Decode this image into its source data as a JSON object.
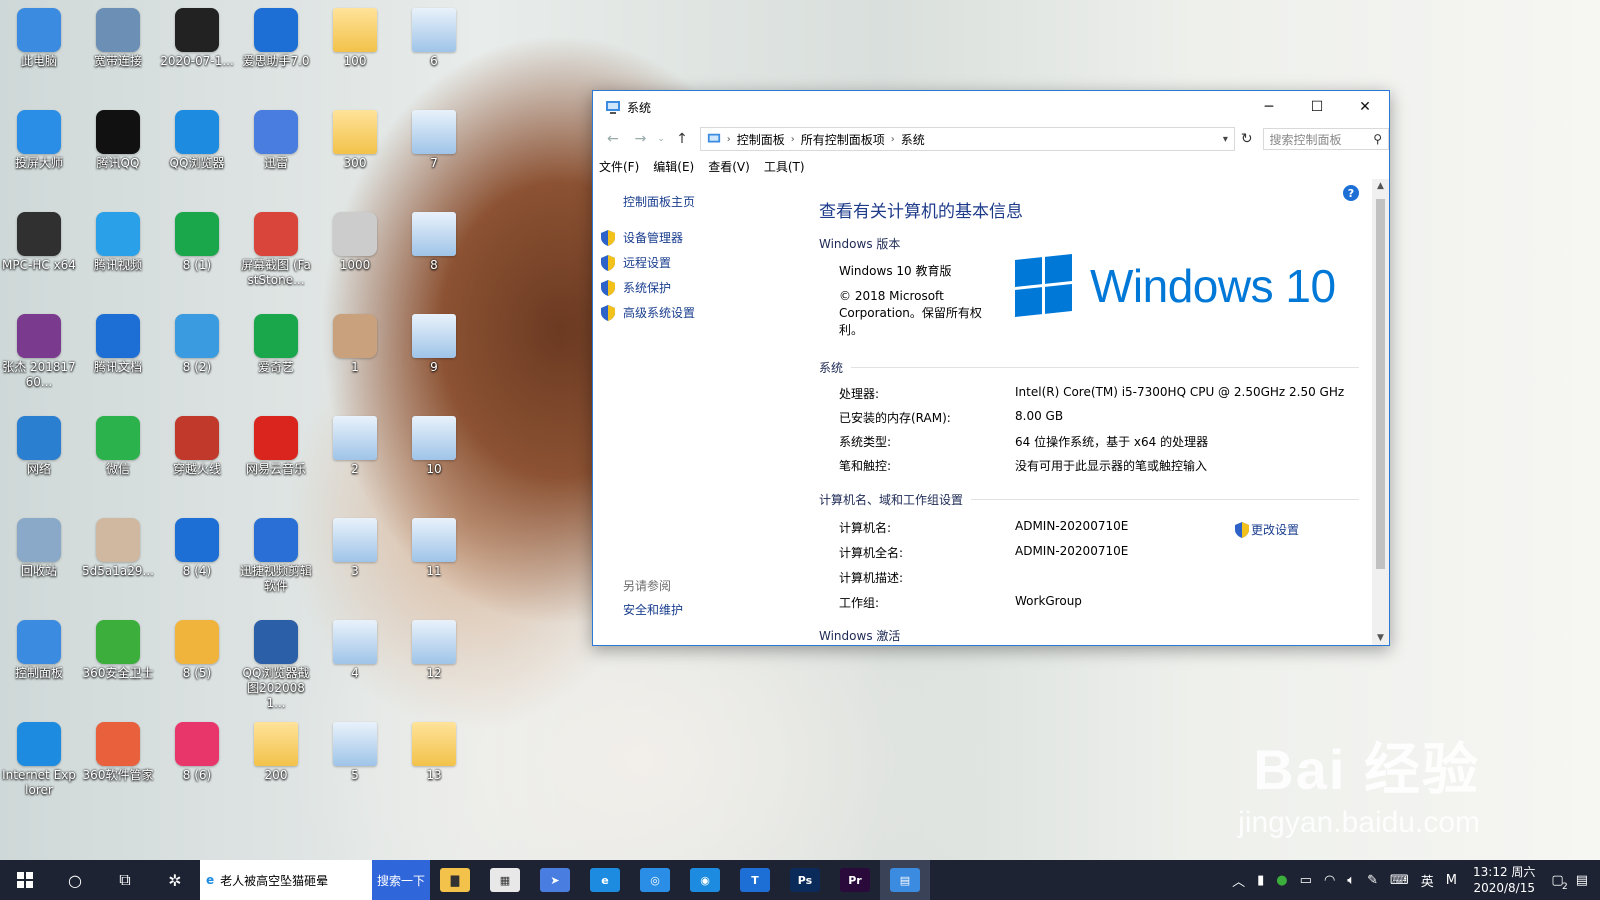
{
  "desktop": {
    "icons": [
      {
        "label": "此电脑",
        "color": "#3b8be0",
        "icon": "computer-icon"
      },
      {
        "label": "宽带连接",
        "color": "#6c8fb5",
        "icon": "broadband-icon"
      },
      {
        "label": "2020-07-1...",
        "color": "#222222",
        "icon": "video-thumbnail-icon"
      },
      {
        "label": "爱思助手7.0",
        "color": "#1d6fd6",
        "icon": "i4-assistant-icon"
      },
      {
        "label": "100",
        "color": "#333333",
        "icon": "folder-icon"
      },
      {
        "label": "6",
        "color": "#5b9be0",
        "icon": "document-icon"
      },
      {
        "label": "投屏大师",
        "color": "#2a8ee6",
        "icon": "screen-cast-icon"
      },
      {
        "label": "腾讯QQ",
        "color": "#111111",
        "icon": "qq-icon"
      },
      {
        "label": "QQ浏览器",
        "color": "#1d8ce0",
        "icon": "qq-browser-icon"
      },
      {
        "label": "迅雷",
        "color": "#4a7de0",
        "icon": "thunder-icon"
      },
      {
        "label": "300",
        "color": "#d86aa0",
        "icon": "folder-icon"
      },
      {
        "label": "7",
        "color": "#5b9be0",
        "icon": "document-icon"
      },
      {
        "label": "MPC-HC x64",
        "color": "#303030",
        "icon": "mpc-hc-icon"
      },
      {
        "label": "腾讯视频",
        "color": "#2aa0e8",
        "icon": "tencent-video-icon"
      },
      {
        "label": "8 (1)",
        "color": "#1aa64a",
        "icon": "iqiyi-icon"
      },
      {
        "label": "屏幕截图 (FastStone...",
        "color": "#d9453a",
        "icon": "faststone-icon"
      },
      {
        "label": "1000",
        "color": "#cccccc",
        "icon": "screenshot-thumbnail-icon"
      },
      {
        "label": "8",
        "color": "#5b9be0",
        "icon": "document-icon"
      },
      {
        "label": "张杰 20181760...",
        "color": "#7a3b8e",
        "icon": "winrar-icon"
      },
      {
        "label": "腾讯文档",
        "color": "#1d6fd6",
        "icon": "tencent-docs-icon"
      },
      {
        "label": "8 (2)",
        "color": "#3a9be0",
        "icon": "baidu-netdisk-icon"
      },
      {
        "label": "爱奇艺",
        "color": "#1aa64a",
        "icon": "iqiyi-icon"
      },
      {
        "label": "1",
        "color": "#c9a27d",
        "icon": "image-icon"
      },
      {
        "label": "9",
        "color": "#5b9be0",
        "icon": "document-icon"
      },
      {
        "label": "网络",
        "color": "#2b7fd1",
        "icon": "network-icon"
      },
      {
        "label": "微信",
        "color": "#2bb24c",
        "icon": "wechat-icon"
      },
      {
        "label": "穿越火线",
        "color": "#c0392b",
        "icon": "crossfire-icon"
      },
      {
        "label": "网易云音乐",
        "color": "#d9251d",
        "icon": "netease-music-icon"
      },
      {
        "label": "2",
        "color": "#5b9be0",
        "icon": "document-icon"
      },
      {
        "label": "10",
        "color": "#5b9be0",
        "icon": "document-icon"
      },
      {
        "label": "回收站",
        "color": "#8aa8c8",
        "icon": "recycle-bin-icon"
      },
      {
        "label": "5d5a1a29...",
        "color": "#d0b8a0",
        "icon": "image-icon"
      },
      {
        "label": "8 (4)",
        "color": "#1d6fd6",
        "icon": "kugou-icon"
      },
      {
        "label": "迅捷视频剪辑软件",
        "color": "#2a6fd6",
        "icon": "video-editor-icon"
      },
      {
        "label": "3",
        "color": "#5b9be0",
        "icon": "document-icon"
      },
      {
        "label": "11",
        "color": "#5b9be0",
        "icon": "document-icon"
      },
      {
        "label": "控制面板",
        "color": "#3b8be0",
        "icon": "control-panel-icon"
      },
      {
        "label": "360安全卫士",
        "color": "#3cae3c",
        "icon": "360-safe-icon"
      },
      {
        "label": "8 (5)",
        "color": "#f0b43c",
        "icon": "video-folder-icon"
      },
      {
        "label": "QQ浏览器截图2020081...",
        "color": "#2b5fa8",
        "icon": "screenshot-thumbnail-icon"
      },
      {
        "label": "4",
        "color": "#5b9be0",
        "icon": "document-icon"
      },
      {
        "label": "12",
        "color": "#5b9be0",
        "icon": "document-icon"
      },
      {
        "label": "Internet Explorer",
        "color": "#1d8ce0",
        "icon": "ie-icon"
      },
      {
        "label": "360软件管家",
        "color": "#e8603c",
        "icon": "360-software-icon"
      },
      {
        "label": "8 (6)",
        "color": "#e8356a",
        "icon": "youku-icon"
      },
      {
        "label": "200",
        "color": "#1d4ea8",
        "icon": "folder-icon"
      },
      {
        "label": "5",
        "color": "#5b9be0",
        "icon": "document-icon"
      },
      {
        "label": "13",
        "color": "#f2c24a",
        "icon": "folder-icon"
      }
    ]
  },
  "window": {
    "title": "系统",
    "controls": {
      "minimize": "─",
      "maximize": "☐",
      "close": "✕"
    },
    "breadcrumb": [
      "控制面板",
      "所有控制面板项",
      "系统"
    ],
    "search_placeholder": "搜索控制面板",
    "menu": [
      "文件(F)",
      "编辑(E)",
      "查看(V)",
      "工具(T)"
    ],
    "left": {
      "home": "控制面板主页",
      "links": [
        "设备管理器",
        "远程设置",
        "系统保护",
        "高级系统设置"
      ],
      "see_also": "另请参阅",
      "security": "安全和维护"
    },
    "main": {
      "title": "查看有关计算机的基本信息",
      "edition_header": "Windows 版本",
      "edition": "Windows 10 教育版",
      "copyright": "© 2018 Microsoft Corporation。保留所有权利。",
      "logo_text": "Windows 10",
      "system_header": "系统",
      "system_rows": [
        {
          "k": "处理器:",
          "v": "Intel(R) Core(TM) i5-7300HQ CPU @ 2.50GHz   2.50 GHz"
        },
        {
          "k": "已安装的内存(RAM):",
          "v": "8.00 GB"
        },
        {
          "k": "系统类型:",
          "v": "64 位操作系统，基于 x64 的处理器"
        },
        {
          "k": "笔和触控:",
          "v": "没有可用于此显示器的笔或触控输入"
        }
      ],
      "computer_header": "计算机名、域和工作组设置",
      "computer_rows": [
        {
          "k": "计算机名:",
          "v": "ADMIN-20200710E"
        },
        {
          "k": "计算机全名:",
          "v": "ADMIN-20200710E"
        },
        {
          "k": "计算机描述:",
          "v": ""
        },
        {
          "k": "工作组:",
          "v": "WorkGroup"
        }
      ],
      "change_settings": "更改设置",
      "activation_header": "Windows 激活"
    }
  },
  "taskbar": {
    "search_text": "老人被高空坠猫砸晕",
    "search_button": "搜索一下",
    "apps": [
      {
        "name": "file-explorer-icon",
        "glyph": "▇",
        "color": "#f2c24a"
      },
      {
        "name": "store-icon",
        "glyph": "▦",
        "color": "#e8e8e8"
      },
      {
        "name": "thunder-icon",
        "glyph": "➤",
        "color": "#4a7de0"
      },
      {
        "name": "edge-icon",
        "glyph": "e",
        "color": "#1d8ce0"
      },
      {
        "name": "screen-cast-icon",
        "glyph": "◎",
        "color": "#2a8ee6"
      },
      {
        "name": "qq-browser-icon",
        "glyph": "◉",
        "color": "#1d8ce0"
      },
      {
        "name": "tencent-docs-icon",
        "glyph": "T",
        "color": "#1d6fd6"
      },
      {
        "name": "photoshop-icon",
        "glyph": "Ps",
        "color": "#0a2a5a"
      },
      {
        "name": "premiere-icon",
        "glyph": "Pr",
        "color": "#2a0a3a"
      },
      {
        "name": "control-panel-icon",
        "glyph": "▤",
        "color": "#3b8be0"
      }
    ],
    "tray": {
      "lang": "英",
      "ime": "M",
      "time": "13:12 周六",
      "date": "2020/8/15",
      "notif_count": "2"
    }
  },
  "watermark": {
    "brand": "Bai 经验",
    "url": "jingyan.baidu.com"
  }
}
